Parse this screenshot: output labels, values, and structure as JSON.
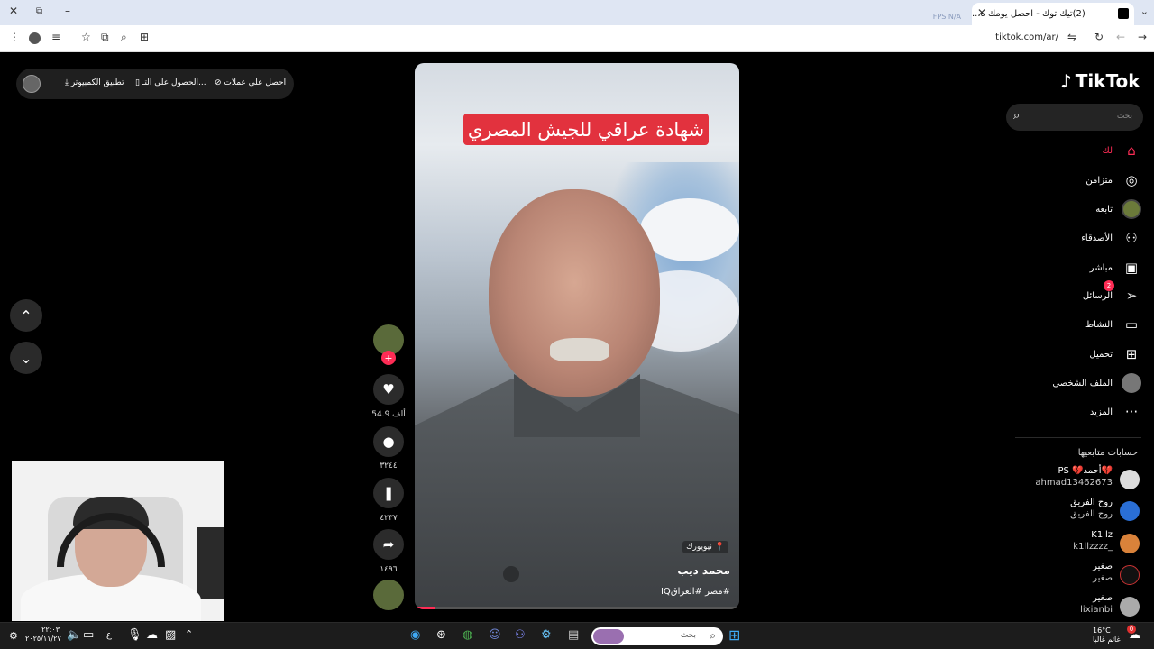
{
  "browser": {
    "tab_title": "(2)تيك توك - احصل يومك ه...",
    "new_tab": "+",
    "fps_label": "FPS  N/A",
    "url": "tiktok.com/ar/"
  },
  "top_bar": {
    "get_coins": "احصل على عملات",
    "get_app": "الحصول على التـ...",
    "desktop_app": "تطبيق الكمبيوتر"
  },
  "video": {
    "overlay_title": "شهادة عراقي للجيش المصري",
    "location": "نيويورك",
    "author": "محمد ديب",
    "hashtags": "#مصر #العراقIQ",
    "progress_fraction": 0.06
  },
  "actions": {
    "likes": "54.9 ألف",
    "comments": "٣٢٤٤",
    "saves": "٤٢٣٧",
    "shares": "١٤٩٦"
  },
  "sidebar": {
    "logo": "TikTok",
    "search_placeholder": "بحث",
    "nav": [
      {
        "label": "لك"
      },
      {
        "label": "متزامن"
      },
      {
        "label": "تابعه"
      },
      {
        "label": "الأصدقاء"
      },
      {
        "label": "مباشر"
      },
      {
        "label": "الرسائل",
        "badge": "2"
      },
      {
        "label": "النشاط"
      },
      {
        "label": "تحميل"
      },
      {
        "label": "الملف الشخصي"
      },
      {
        "label": "المزيد"
      }
    ],
    "following_title": "حسابات متابعيها",
    "following": [
      {
        "name": "💔أحمد💔 PS",
        "user": "ahmad13462673"
      },
      {
        "name": "روح الفريق",
        "user": "روح الفريق"
      },
      {
        "name": "K1llz",
        "user": "k1llzzzz_"
      },
      {
        "name": "صغير",
        "user": "صغير"
      },
      {
        "name": "صغير",
        "user": "lixianbi"
      }
    ]
  },
  "taskbar": {
    "search_placeholder": "بحث",
    "time": "٢٢:٠٣",
    "date": "٢٠٢٥/١١/٢٧",
    "lang": "ع",
    "temp": "16°C",
    "weather": "غائم غالبا",
    "notif_count": "0"
  }
}
